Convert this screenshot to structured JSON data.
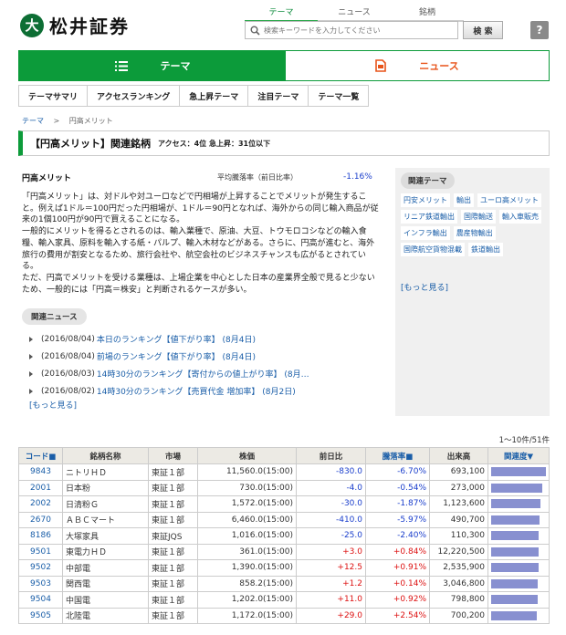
{
  "header": {
    "logo_mark": "大",
    "logo_text": "松井証券",
    "nav": [
      "テーマ",
      "ニュース",
      "銘柄"
    ],
    "search_placeholder": "検索キーワードを入力してください",
    "search_button": "検 索",
    "help": "?"
  },
  "tabs": {
    "theme": "テーマ",
    "news": "ニュース"
  },
  "subnav": [
    "テーマサマリ",
    "アクセスランキング",
    "急上昇テーマ",
    "注目テーマ",
    "テーマ一覧"
  ],
  "breadcrumb": {
    "root": "テーマ",
    "sep": ">",
    "current": "円高メリット"
  },
  "heading": {
    "title": "【円高メリット】関連銘柄",
    "meta": "アクセス：4位 急上昇：31位以下"
  },
  "theme": {
    "name": "円高メリット",
    "avg_label": "平均騰落率（前日比率）",
    "avg_value": "-1.16%",
    "description": [
      "「円高メリット」は、対ドルや対ユーロなどで円相場が上昇することでメリットが発生すること。例えば1ドル＝100円だった円相場が、1ドル＝90円となれば、海外からの同じ輸入商品が従来の1個100円が90円で買えることになる。",
      "一般的にメリットを得るとされるのは、輸入業種で、原油、大豆、トウモロコシなどの輸入食糧、輸入家具、原料を輸入する紙・パルプ、輸入木材などがある。さらに、円高が進むと、海外旅行の費用が割安となるため、旅行会社や、航空会社のビジネスチャンスも広がるとされている。",
      "ただ、円高でメリットを受ける業種は、上場企業を中心とした日本の産業界全般で見ると少ないため、一般的には「円高＝株安」と判断されるケースが多い。"
    ]
  },
  "news": {
    "heading": "関連ニュース",
    "items": [
      {
        "date": "(2016/08/04)",
        "title": "本日のランキング【値下がり率】 (8月4日)"
      },
      {
        "date": "(2016/08/04)",
        "title": "前場のランキング【値下がり率】 (8月4日)"
      },
      {
        "date": "(2016/08/03)",
        "title": "14時30分のランキング【寄付からの値上がり率】 (8月…"
      },
      {
        "date": "(2016/08/02)",
        "title": "14時30分のランキング【売買代金 増加率】 (8月2日)"
      }
    ],
    "more": "[もっと見る]"
  },
  "related": {
    "heading": "関連テーマ",
    "tags": [
      "円安メリット",
      "輸出",
      "ユーロ高メリット",
      "リニア鉄道輸出",
      "国際輸送",
      "輸入車販売",
      "インフラ輸出",
      "農産物輸出",
      "国際航空貨物混載",
      "鉄道輸出"
    ],
    "more": "[もっと見る]"
  },
  "table": {
    "count": "1～10件/51件",
    "headers": [
      "コード■",
      "銘柄名称",
      "市場",
      "株価",
      "前日比",
      "騰落率■",
      "出来高",
      "関連度▼"
    ],
    "rows": [
      {
        "code": "9843",
        "name": "ニトリＨＤ",
        "market": "東証１部",
        "price": "11,560.0(15:00)",
        "change": "-830.0",
        "rate": "-6.70%",
        "volume": "693,100",
        "relevance": 1.0
      },
      {
        "code": "2001",
        "name": "日本粉",
        "market": "東証１部",
        "price": "730.0(15:00)",
        "change": "-4.0",
        "rate": "-0.54%",
        "volume": "273,000",
        "relevance": 0.93
      },
      {
        "code": "2002",
        "name": "日清粉Ｇ",
        "market": "東証１部",
        "price": "1,572.0(15:00)",
        "change": "-30.0",
        "rate": "-1.87%",
        "volume": "1,123,600",
        "relevance": 0.9
      },
      {
        "code": "2670",
        "name": "ＡＢＣマート",
        "market": "東証１部",
        "price": "6,460.0(15:00)",
        "change": "-410.0",
        "rate": "-5.97%",
        "volume": "490,700",
        "relevance": 0.88
      },
      {
        "code": "8186",
        "name": "大塚家具",
        "market": "東証JQS",
        "price": "1,016.0(15:00)",
        "change": "-25.0",
        "rate": "-2.40%",
        "volume": "110,300",
        "relevance": 0.87
      },
      {
        "code": "9501",
        "name": "東電力ＨＤ",
        "market": "東証１部",
        "price": "361.0(15:00)",
        "change": "+3.0",
        "rate": "+0.84%",
        "volume": "12,220,500",
        "relevance": 0.86
      },
      {
        "code": "9502",
        "name": "中部電",
        "market": "東証１部",
        "price": "1,390.0(15:00)",
        "change": "+12.5",
        "rate": "+0.91%",
        "volume": "2,535,900",
        "relevance": 0.86
      },
      {
        "code": "9503",
        "name": "関西電",
        "market": "東証１部",
        "price": "858.2(15:00)",
        "change": "+1.2",
        "rate": "+0.14%",
        "volume": "3,046,800",
        "relevance": 0.85
      },
      {
        "code": "9504",
        "name": "中国電",
        "market": "東証１部",
        "price": "1,202.0(15:00)",
        "change": "+11.0",
        "rate": "+0.92%",
        "volume": "798,800",
        "relevance": 0.85
      },
      {
        "code": "9505",
        "name": "北陸電",
        "market": "東証１部",
        "price": "1,172.0(15:00)",
        "change": "+29.0",
        "rate": "+2.54%",
        "volume": "700,200",
        "relevance": 0.84
      }
    ]
  },
  "colors": {
    "brand_green": "#0c9b3a",
    "news_orange": "#e8541a",
    "link_blue": "#1a5ea8",
    "negative": "#1a3ecc",
    "positive": "#dd1111",
    "relevance_bar": "#8890d0"
  }
}
